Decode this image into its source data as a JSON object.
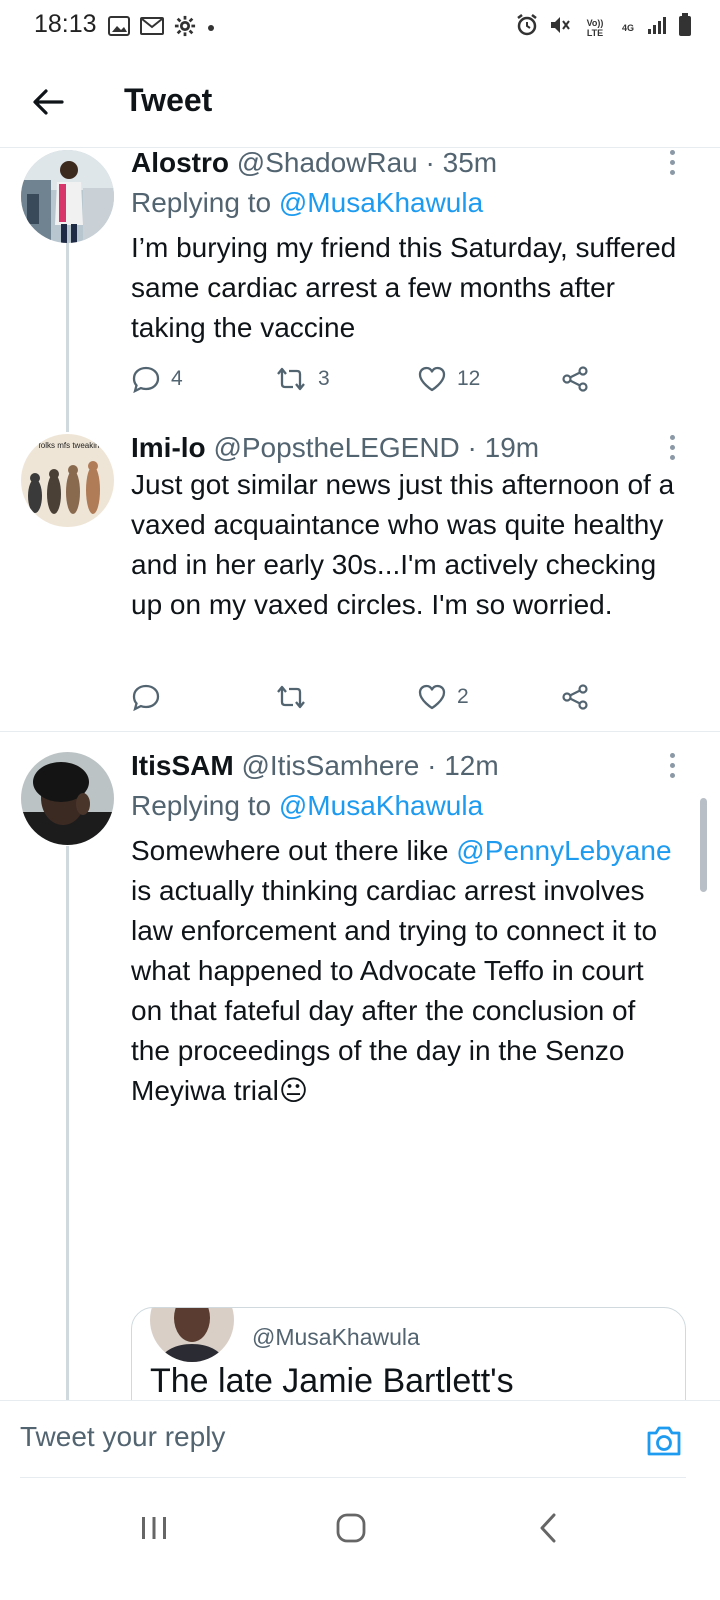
{
  "status_bar": {
    "time": "18:13",
    "network_volte": "Vo)) LTE",
    "network_type": "4G",
    "left_icons": [
      "image-icon",
      "gmail-icon",
      "gear-icon",
      "dot-icon"
    ],
    "right_icons": [
      "alarm-icon",
      "mute-icon",
      "volte-icon",
      "4g-icon",
      "signal-icon",
      "battery-icon"
    ]
  },
  "header": {
    "title": "Tweet",
    "back_icon": "arrow-left-icon"
  },
  "tweets": [
    {
      "name": "Alostro",
      "handle": "@ShadowRau",
      "separator": "·",
      "time": "35m",
      "replying_prefix": "Replying to ",
      "replying_to": "@MusaKhawula",
      "text": "I’m burying my friend this Saturday, suffered same cardiac arrest a few months after taking the vaccine",
      "replies": "4",
      "retweets": "3",
      "likes": "12"
    },
    {
      "name": "Imi-lo",
      "handle": "@PopstheLEGEND",
      "separator": "·",
      "time": "19m",
      "text": "Just got similar news just this afternoon of a vaxed acquaintance who was quite healthy and in her early 30s...I'm actively checking up on my vaxed circles. I'm so worried.",
      "replies": "",
      "retweets": "",
      "likes": "2",
      "avatar_text": "folks mfs tweakin"
    },
    {
      "name": "ItisSAM",
      "handle": "@ItisSamhere",
      "separator": "·",
      "time": "12m",
      "replying_prefix": "Replying to ",
      "replying_to": "@MusaKhawula",
      "text_1": "Somewhere out there like ",
      "text_mention": "@PennyLebyane",
      "text_2": " is actually thinking cardiac arrest involves law enforcement and trying to connect it to what happened to Advocate Teffo in court on that fateful day after the conclusion of the proceedings of the day in the Senzo Meyiwa trial",
      "emoji": "😐",
      "quote": {
        "handle": "@MusaKhawula",
        "text": "The late Jamie Bartlett's management releases a statement detailing Jamie suffered a cardiac arrest on the 22nd May 2022"
      }
    }
  ],
  "reply_composer": {
    "placeholder": "Tweet your reply",
    "camera_icon": "camera-icon"
  },
  "nav_bar": {
    "icons": [
      "recent-apps-icon",
      "home-icon",
      "back-icon"
    ]
  },
  "colors": {
    "accent": "#1d9bf0",
    "secondary_text": "#536471",
    "divider": "#e6ecf0"
  }
}
